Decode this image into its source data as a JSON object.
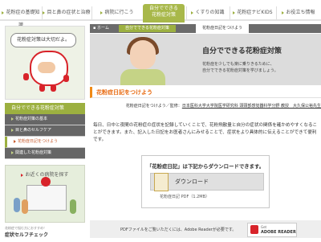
{
  "topnav": {
    "tabs": [
      {
        "label": "花粉症の基礎知識"
      },
      {
        "label": "目と鼻の症状と治療"
      },
      {
        "label": "病院に行こう"
      },
      {
        "label_line1": "自分でできる",
        "label_line2": "花粉症対策"
      },
      {
        "label": "くすりの知識"
      },
      {
        "label": "花粉症ナビKIDS"
      },
      {
        "label": "お役立ち情報"
      }
    ]
  },
  "sidebar": {
    "speech": "花粉症対策は大切だよ。",
    "menu_title": "自分でできる花粉症対策",
    "items": [
      {
        "label": "花粉症対策の基本"
      },
      {
        "label": "目と鼻のセルフケア"
      },
      {
        "label": "花粉症日記をつけよう"
      },
      {
        "label": "関連した花粉症対策"
      }
    ],
    "hospital_title": "お近くの病院を探す",
    "check_label_small": "花粉症で悩む方におすすめ！",
    "check_label": "症状セルフチェック"
  },
  "breadcrumb": {
    "home": "ホーム",
    "middle": "自分でできる花粉症対策",
    "current": "花粉症日記をつけよう"
  },
  "banner": {
    "title": "自分でできる花粉症対策",
    "sub1": "花粉症を少しでも楽に乗りきるために、",
    "sub2": "自分でできる花粉症対策を学びましょう。"
  },
  "content": {
    "heading": "花粉症日記をつけよう",
    "byline_prefix": "花粉症日記をつけよう／監修：",
    "byline_name": "日本医科大学大学院医学研究科 頭頸部感覚器科学分野 教授　大久保公裕先生",
    "paragraph": "毎日、日中と夜間の花粉症の症状を記録していくことで、花粉飛散量と自分の症状の関係を確かめやすくなることができます。また、記入した日記をお医者さんにみせることで、症状をより具体的に伝えることができて便利です。"
  },
  "download": {
    "heading": "「花粉症日記」は下記からダウンロードできます。",
    "button": "ダウンロード",
    "note": "花粉症日記 PDF（1.2MB）"
  },
  "pdf_notice": {
    "text": "PDFファイルをご覧いただくには、Adobe Readerが必要です。",
    "badge_small": "Get",
    "badge": "ADOBE READER"
  },
  "colors": {
    "accent_green": "#9cb040",
    "accent_orange": "#f08a16",
    "mascot_red": "#d8232a"
  }
}
